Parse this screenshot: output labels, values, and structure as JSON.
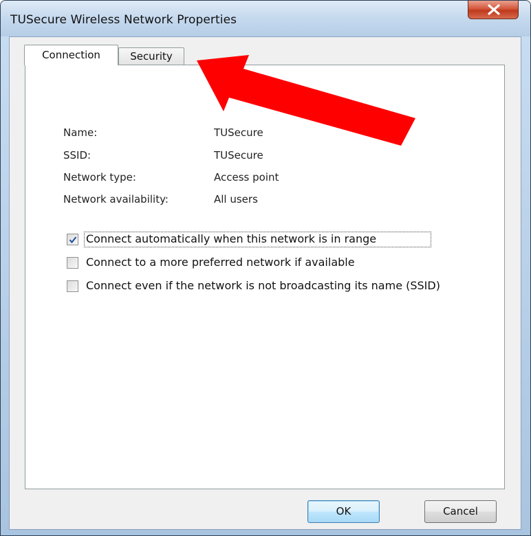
{
  "window": {
    "title": "TUSecure Wireless Network Properties"
  },
  "tabs": [
    {
      "label": "Connection",
      "selected": true
    },
    {
      "label": "Security",
      "selected": false
    }
  ],
  "info": [
    {
      "label": "Name:",
      "value": "TUSecure"
    },
    {
      "label": "SSID:",
      "value": "TUSecure"
    },
    {
      "label": "Network type:",
      "value": "Access point"
    },
    {
      "label": "Network availability:",
      "value": "All users"
    }
  ],
  "options": [
    {
      "label": "Connect automatically when this network is in range",
      "checked": true
    },
    {
      "label": "Connect to a more preferred network if available",
      "checked": false
    },
    {
      "label": "Connect even if the network is not broadcasting its name (SSID)",
      "checked": false
    }
  ],
  "buttons": {
    "ok": "OK",
    "cancel": "Cancel"
  },
  "annotation": {
    "color": "#ff0000",
    "icon": "arrow-annotation-icon"
  }
}
